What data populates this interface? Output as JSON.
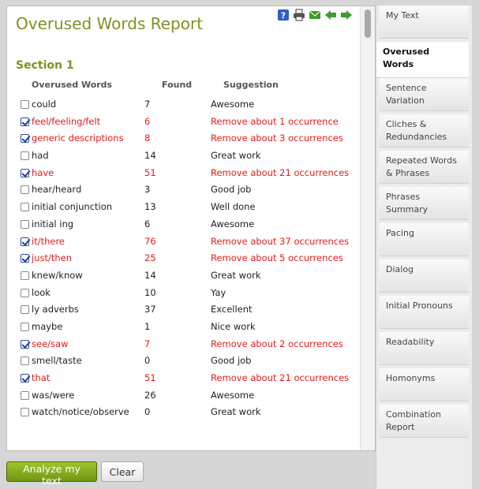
{
  "report": {
    "title": "Overused Words Report",
    "section_title": "Section 1",
    "columns": {
      "word": "Overused Words",
      "found": "Found",
      "suggestion": "Suggestion"
    },
    "rows": [
      {
        "word": "could",
        "found": "7",
        "suggestion": "Awesome",
        "checked": false
      },
      {
        "word": "feel/feeling/felt",
        "found": "6",
        "suggestion": "Remove about 1 occurrence",
        "checked": true
      },
      {
        "word": "generic descriptions",
        "found": "8",
        "suggestion": "Remove about 3 occurrences",
        "checked": true
      },
      {
        "word": "had",
        "found": "14",
        "suggestion": "Great work",
        "checked": false
      },
      {
        "word": "have",
        "found": "51",
        "suggestion": "Remove about 21 occurrences",
        "checked": true
      },
      {
        "word": "hear/heard",
        "found": "3",
        "suggestion": "Good job",
        "checked": false
      },
      {
        "word": "initial conjunction",
        "found": "13",
        "suggestion": "Well done",
        "checked": false
      },
      {
        "word": "initial ing",
        "found": "6",
        "suggestion": "Awesome",
        "checked": false
      },
      {
        "word": "it/there",
        "found": "76",
        "suggestion": "Remove about 37 occurrences",
        "checked": true
      },
      {
        "word": "just/then",
        "found": "25",
        "suggestion": "Remove about 5 occurrences",
        "checked": true
      },
      {
        "word": "knew/know",
        "found": "14",
        "suggestion": "Great work",
        "checked": false
      },
      {
        "word": "look",
        "found": "10",
        "suggestion": "Yay",
        "checked": false
      },
      {
        "word": "ly adverbs",
        "found": "37",
        "suggestion": "Excellent",
        "checked": false
      },
      {
        "word": "maybe",
        "found": "1",
        "suggestion": "Nice work",
        "checked": false
      },
      {
        "word": "see/saw",
        "found": "7",
        "suggestion": "Remove about 2 occurrences",
        "checked": true
      },
      {
        "word": "smell/taste",
        "found": "0",
        "suggestion": "Good job",
        "checked": false
      },
      {
        "word": "that",
        "found": "51",
        "suggestion": "Remove about 21 occurrences",
        "checked": true
      },
      {
        "word": "was/were",
        "found": "26",
        "suggestion": "Awesome",
        "checked": false
      },
      {
        "word": "watch/notice/observe",
        "found": "0",
        "suggestion": "Great work",
        "checked": false
      }
    ]
  },
  "toolbar": {
    "icons": [
      "help-icon",
      "print-icon",
      "email-icon",
      "back-arrow-icon",
      "forward-arrow-icon"
    ],
    "help_glyph": "?"
  },
  "tabs": [
    {
      "label": "My Text",
      "active": false
    },
    {
      "label": "Overused Words",
      "active": true
    },
    {
      "label": "Sentence Variation",
      "active": false
    },
    {
      "label": "Cliches & Redundancies",
      "active": false
    },
    {
      "label": "Repeated Words & Phrases",
      "active": false
    },
    {
      "label": "Phrases Summary",
      "active": false
    },
    {
      "label": "Pacing",
      "active": false
    },
    {
      "label": "Dialog",
      "active": false
    },
    {
      "label": "Initial Pronouns",
      "active": false
    },
    {
      "label": "Readability",
      "active": false
    },
    {
      "label": "Homonyms",
      "active": false
    },
    {
      "label": "Combination Report",
      "active": false
    }
  ],
  "buttons": {
    "analyze": "Analyze my text",
    "clear": "Clear"
  },
  "colors": {
    "accent": "#80921f",
    "flag": "#e41b1b",
    "analyze_button": "#86ad1d"
  }
}
